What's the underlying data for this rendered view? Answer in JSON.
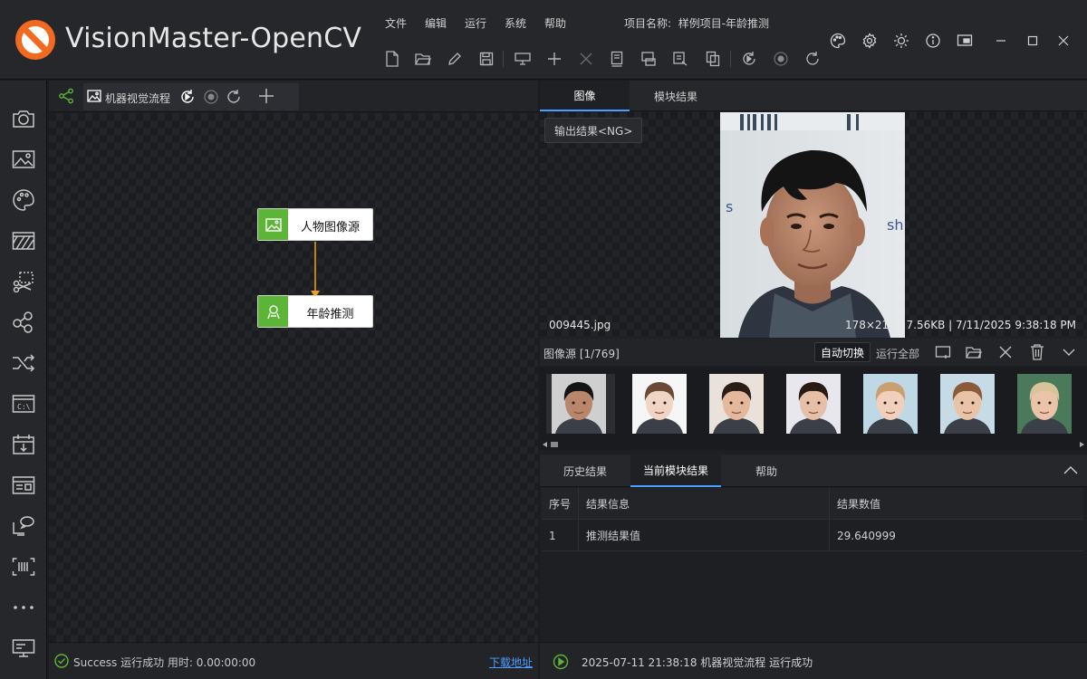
{
  "app": {
    "title": "VisionMaster-OpenCV",
    "menu": [
      "文件",
      "编辑",
      "运行",
      "系统",
      "帮助"
    ],
    "project_label": "项目名称:",
    "project_name": "样例项目-年龄推测"
  },
  "toolbar": {
    "icons": [
      "new-file-icon",
      "open-folder-icon",
      "edit-icon",
      "save-icon",
      "camera-settings-icon",
      "add-icon",
      "delete-icon",
      "book-icon",
      "export-icon",
      "stamp-icon",
      "copy-icon",
      "run-once-icon",
      "record-icon",
      "loop-icon"
    ]
  },
  "window_controls": [
    "palette-icon",
    "settings-icon",
    "brightness-icon",
    "info-icon",
    "screen-icon",
    "minimize-icon",
    "maximize-icon",
    "close-icon"
  ],
  "sidebar": {
    "icons": [
      "camera-icon",
      "image-icon",
      "palette-icon",
      "pattern-icon",
      "crop-icon",
      "nodes-icon",
      "shuffle-icon",
      "terminal-icon",
      "calendar-icon",
      "layout-icon",
      "chat-monitor-icon",
      "barcode-icon",
      "more-icon",
      "monitor-icon"
    ]
  },
  "canvas": {
    "flow_tab": "机器视觉流程",
    "nodes": [
      {
        "label": "人物图像源",
        "icon": "image-icon"
      },
      {
        "label": "年龄推测",
        "icon": "face-icon"
      }
    ],
    "status": "Success 运行成功 用时: 0.00:00:00",
    "download_link": "下载地址"
  },
  "image_panel": {
    "tabs": [
      "图像",
      "模块结果"
    ],
    "active_tab": "图像",
    "result_badge": "输出结果<NG>",
    "file_name": "009445.jpg",
    "file_meta": "178×218 | 7.56KB | 7/11/2025 9:38:18 PM"
  },
  "source": {
    "label": "图像源 [1/769]",
    "auto_switch": "自动切换",
    "run_all": "运行全部",
    "icons": [
      "add-screen-icon",
      "open-folder-icon",
      "close-icon",
      "trash-icon",
      "chevron-down-icon"
    ],
    "thumbnails": [
      {
        "name": "thumb-1",
        "skin": "#b8866a",
        "hair": "#141414",
        "bg": "#cfcfcf",
        "selected": true
      },
      {
        "name": "thumb-2",
        "skin": "#f1d5c4",
        "hair": "#6a4a36",
        "bg": "#f6f6f6",
        "selected": false
      },
      {
        "name": "thumb-3",
        "skin": "#e3b89b",
        "hair": "#2a1c16",
        "bg": "#e8e2da",
        "selected": false
      },
      {
        "name": "thumb-4",
        "skin": "#e5c0a6",
        "hair": "#2a1a14",
        "bg": "#e9e7ee",
        "selected": false
      },
      {
        "name": "thumb-5",
        "skin": "#f0d0bd",
        "hair": "#c9a070",
        "bg": "#bfd8e6",
        "selected": false
      },
      {
        "name": "thumb-6",
        "skin": "#e9c3a8",
        "hair": "#8a5a3a",
        "bg": "#c6dbe6",
        "selected": false
      },
      {
        "name": "thumb-7",
        "skin": "#eac3a9",
        "hair": "#d8c49a",
        "bg": "#4a7a5a",
        "selected": false
      }
    ]
  },
  "results": {
    "tabs": [
      "历史结果",
      "当前模块结果",
      "帮助"
    ],
    "active_tab": "当前模块结果",
    "columns": [
      "序号",
      "结果信息",
      "结果数值"
    ],
    "rows": [
      {
        "index": "1",
        "info": "推测结果值",
        "value": "29.640999"
      }
    ]
  },
  "log": {
    "text": "2025-07-11 21:38:18 机器视觉流程 运行成功"
  },
  "colors": {
    "accent": "#4a9eff",
    "node_green": "#5db537",
    "connector": "#f0a020",
    "logo_orange": "#f26a21"
  }
}
